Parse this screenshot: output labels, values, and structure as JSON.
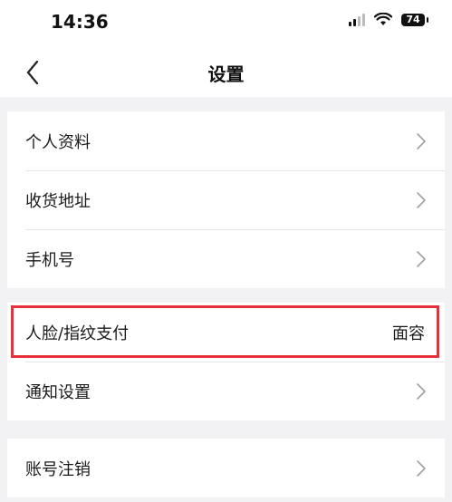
{
  "status_bar": {
    "time": "14:36",
    "battery": "74",
    "icons": [
      "cellular-signal-icon",
      "wifi-icon",
      "battery-icon"
    ]
  },
  "nav": {
    "title": "设置",
    "back_icon": "chevron-left-icon"
  },
  "groups": [
    {
      "items": [
        {
          "label": "个人资料",
          "icon": "chevron-right-icon"
        },
        {
          "label": "收货地址",
          "icon": "chevron-right-icon"
        },
        {
          "label": "手机号",
          "icon": "chevron-right-icon"
        }
      ]
    },
    {
      "items": [
        {
          "label": "人脸/指纹支付",
          "value": "面容"
        },
        {
          "label": "通知设置",
          "icon": "chevron-right-icon"
        }
      ]
    },
    {
      "items": [
        {
          "label": "账号注销",
          "icon": "chevron-right-icon"
        }
      ]
    }
  ],
  "colors": {
    "background": "#f2f2f4",
    "highlight_border": "#e5323a",
    "divider": "#e6e6e8"
  }
}
